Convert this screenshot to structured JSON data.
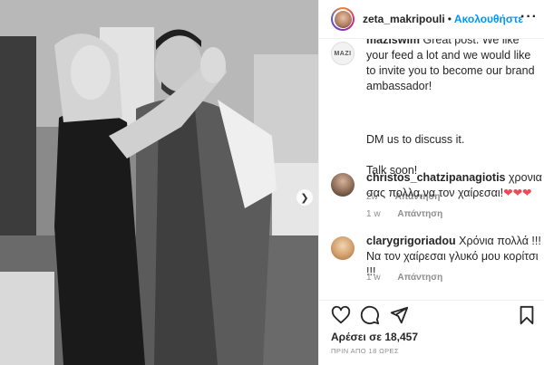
{
  "post": {
    "author": "zeta_makripouli",
    "follow_label": "Ακολουθήστε",
    "dot": "•",
    "more_label": "···"
  },
  "comments": [
    {
      "avatar_text": "MAZI",
      "username": "maziswim",
      "text": "Great post. We like your feed a lot and we would like to invite you to become our brand ambassador!",
      "text2": "DM us to discuss it.",
      "text3": "Talk soon!",
      "age": "2w",
      "reply": "Απάντηση"
    },
    {
      "username": "christos_chatzipanagiotis",
      "text": "χρονια σας πολλα,να τον χαίρεσαι!",
      "hearts": "❤❤❤",
      "age": "1 w",
      "reply": "Απάντηση"
    },
    {
      "username": "clarygrigoriadou",
      "text": "Χρόνια πολλά !!! Να τον χαίρεσαι γλυκό μου κορίτσι !!!",
      "age": "1 w",
      "reply": "Απάντηση"
    }
  ],
  "actions": {
    "like_icon": "heart-icon",
    "comment_icon": "comment-icon",
    "share_icon": "share-icon",
    "save_icon": "bookmark-icon"
  },
  "likes_text": "Αρέσει σε 18,457",
  "timestamp": "ΠΡΙΝ ΑΠΟ 18 ΩΡΕΣ",
  "colors": {
    "accent": "#0095f6",
    "text": "#262626",
    "muted": "#8e8e8e",
    "heart": "#ed4956"
  }
}
